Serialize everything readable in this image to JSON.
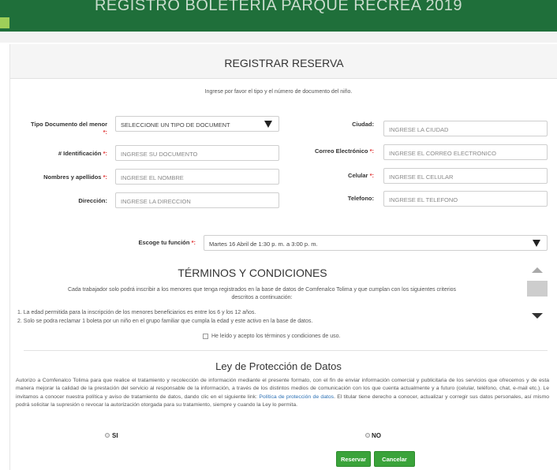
{
  "header": {
    "title": "REGISTRO BOLETERIA PARQUE RECREA 2019"
  },
  "form": {
    "title": "REGISTRAR RESERVA",
    "intro": "Ingrese por favor el tipo y el número de documento del niño.",
    "fields": {
      "tipo_documento": {
        "label": "Tipo Documento del menor",
        "required_mark": "*:",
        "value": "SELECCIONE UN TIPO DE DOCUMENT"
      },
      "identificacion": {
        "label": "# Identificación",
        "required_mark": "*:",
        "placeholder": "INGRESE SU DOCUMENTO"
      },
      "nombres": {
        "label": "Nombres y apellidos",
        "required_mark": "*:",
        "placeholder": "INGRESE EL NOMBRE"
      },
      "direccion": {
        "label": "Dirección:",
        "placeholder": "INGRESE LA DIRECCION"
      },
      "ciudad": {
        "label": "Ciudad:",
        "placeholder": "INGRESE LA CIUDAD"
      },
      "correo": {
        "label": "Correo Electrónico",
        "required_mark": "*:",
        "placeholder": "INGRESE EL CORREO ELECTRONICO"
      },
      "celular": {
        "label": "Celular",
        "required_mark": "*:",
        "placeholder": "INGRESE EL CELULAR"
      },
      "telefono": {
        "label": "Telefono:",
        "placeholder": "INGRESE EL TELEFONO"
      }
    },
    "funcion": {
      "label": "Escoge tu función",
      "required_mark": "*:",
      "value": "Martes 16 Abril de 1:30 p. m. a 3:00 p. m."
    }
  },
  "terms": {
    "title": "TÉRMINOS Y CONDICIONES",
    "intro_line1": "Cada trabajador solo podrá inscribir a los menores que tenga registrados en la base de datos de Comfenalco Tolima y que cumplan con los siguientes criterios",
    "intro_line2": "descritos a continuación:",
    "item1": "1. La edad permitida para la inscripción de los menores beneficiarios es entre los 6 y los 12 años.",
    "item2": "2. Solo se podra reclamar 1 boleta por un niño en el grupo familiar que cumpla la edad y este activo en la base de datos.",
    "accept_label": "He leído y acepto los términos y condiciones de uso."
  },
  "ley": {
    "title": "Ley de Protección de Datos",
    "text_before_link": "Autorizo a Comfenalco Tolima para que realice el tratamiento y recolección de información mediante el presente formato, con el fin de enviar información comercial y publicitaria de los servicios que ofrecemos y de esta manera mejorar la calidad de la prestación del servicio al responsable de la información, a través de los distintos medios de comunicación con los que cuenta actualmente y a futuro (celular, teléfono, chat, e-mail etc.). Le invitamos a conocer nuestra política y aviso de tratamiento de datos, dando clic en el siguiente link:",
    "link_text": "Política de protección de datos",
    "text_after_link": ". El titular tiene derecho a conocer, actualizar y corregir sus datos personales, así mismo podrá solicitar la supresión o revocar la autorización otorgada para su tratamiento, siempre y cuando la Ley lo permita.",
    "option_si": "SI",
    "option_no": "NO"
  },
  "buttons": {
    "reservar": "Reservar",
    "cancelar": "Cancelar"
  },
  "colors": {
    "header_green": "#1f6f3a",
    "button_green": "#3aa33a",
    "required_red": "#e03030",
    "link_blue": "#2a6fb3"
  }
}
